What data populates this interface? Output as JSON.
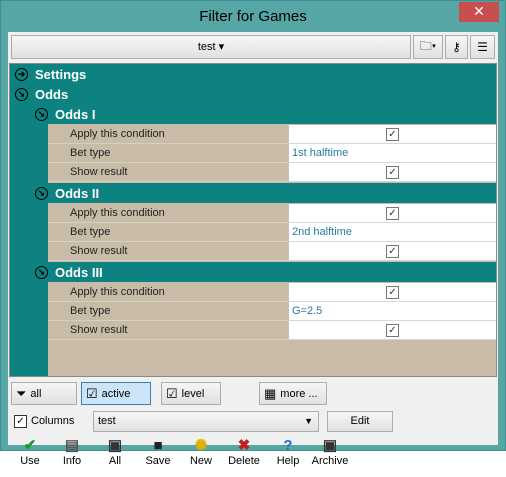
{
  "window": {
    "title": "Filter for Games",
    "close_symbol": "✕"
  },
  "toolbar": {
    "filter_name": "test ▾",
    "icons": [
      "folder-icon",
      "key-icon",
      "tree-view-icon"
    ]
  },
  "tree": {
    "groups": [
      {
        "label": "Settings"
      },
      {
        "label": "Odds"
      }
    ],
    "subgroups": [
      {
        "label": "Odds I",
        "rows": [
          {
            "label": "Apply this condition",
            "value": "",
            "checked": true
          },
          {
            "label": "Bet type",
            "value": "1st halftime",
            "checked": false
          },
          {
            "label": "Show result",
            "value": "",
            "checked": true
          }
        ]
      },
      {
        "label": "Odds II",
        "rows": [
          {
            "label": "Apply this condition",
            "value": "",
            "checked": true
          },
          {
            "label": "Bet type",
            "value": "2nd halftime",
            "checked": false
          },
          {
            "label": "Show result",
            "value": "",
            "checked": true
          }
        ]
      },
      {
        "label": "Odds III",
        "rows": [
          {
            "label": "Apply this condition",
            "value": "",
            "checked": true
          },
          {
            "label": "Bet type",
            "value": "G=2.5",
            "checked": false
          },
          {
            "label": "Show result",
            "value": "",
            "checked": true
          }
        ]
      }
    ]
  },
  "filter_buttons": {
    "all": "all",
    "active": "active",
    "level": "level",
    "more": "more ..."
  },
  "columns": {
    "label": "Columns",
    "checked": true,
    "selected": "test",
    "edit": "Edit"
  },
  "actions": [
    {
      "label": "Use",
      "icon": "checkmark-icon",
      "glyph": "✔",
      "color": "#1a9a2a"
    },
    {
      "label": "Info",
      "icon": "info-icon",
      "glyph": "▤",
      "color": "#555555"
    },
    {
      "label": "All",
      "icon": "folders-icon",
      "glyph": "▣",
      "color": "#333333"
    },
    {
      "label": "Save",
      "icon": "save-icon",
      "glyph": "■",
      "color": "#222222"
    },
    {
      "label": "New",
      "icon": "lightbulb-icon",
      "glyph": "✺",
      "color": "#e0b000"
    },
    {
      "label": "Delete",
      "icon": "delete-icon",
      "glyph": "✖",
      "color": "#c02020"
    },
    {
      "label": "Help",
      "icon": "help-icon",
      "glyph": "?",
      "color": "#1e6fd0"
    },
    {
      "label": "Archive",
      "icon": "archive-icon",
      "glyph": "▣",
      "color": "#333333"
    }
  ]
}
